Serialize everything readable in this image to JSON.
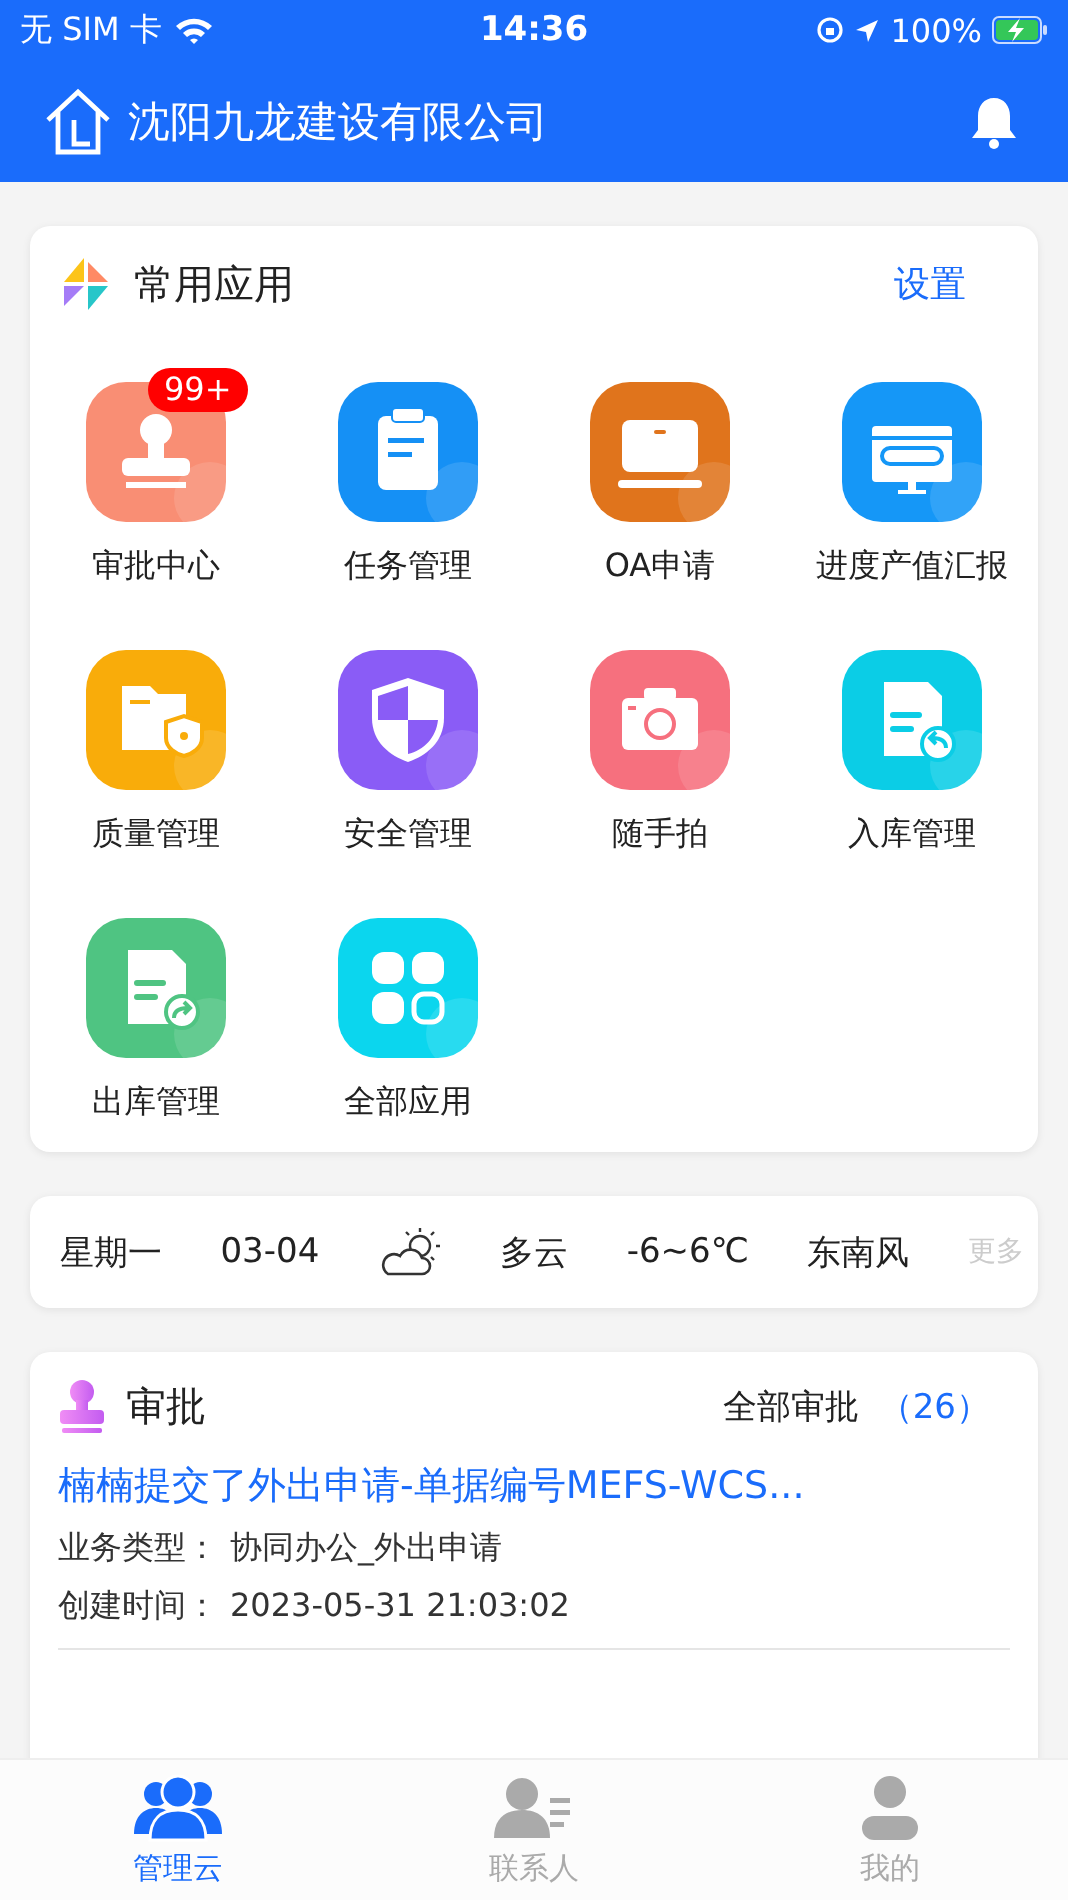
{
  "status_bar": {
    "carrier": "无 SIM 卡",
    "time": "14:36",
    "battery": "100%"
  },
  "header": {
    "title": "沈阳九龙建设有限公司"
  },
  "apps_card": {
    "title": "常用应用",
    "action": "设置",
    "apps": [
      {
        "label": "审批中心",
        "kind": "stamp",
        "color": "#f98e74",
        "badge": "99+"
      },
      {
        "label": "任务管理",
        "kind": "clipboard",
        "color": "#1590f5"
      },
      {
        "label": "OA申请",
        "kind": "laptop",
        "color": "#e0741c"
      },
      {
        "label": "进度产值汇报",
        "kind": "monitor",
        "color": "#1597f7"
      },
      {
        "label": "质量管理",
        "kind": "folder",
        "color": "#f9ac0a"
      },
      {
        "label": "安全管理",
        "kind": "shield",
        "color": "#8a5cf6"
      },
      {
        "label": "随手拍",
        "kind": "camera",
        "color": "#f6707e"
      },
      {
        "label": "入库管理",
        "kind": "doc-in",
        "color": "#0bcde6"
      },
      {
        "label": "出库管理",
        "kind": "doc-out",
        "color": "#4fc482"
      },
      {
        "label": "全部应用",
        "kind": "grid",
        "color": "#0bd6ee"
      }
    ]
  },
  "weather": {
    "weekday": "星期一",
    "date": "03-04",
    "condition": "多云",
    "temperature": "-6~6℃",
    "wind": "东南风",
    "more": "更多"
  },
  "approvals": {
    "title": "审批",
    "all_label": "全部审批",
    "count": "（26）",
    "items": [
      {
        "title": "楠楠提交了外出申请-单据编号MEFS-WCS...",
        "type_label": "业务类型：",
        "type": "协同办公_外出申请",
        "time_label": "创建时间：",
        "time": "2023-05-31 21:03:02"
      }
    ]
  },
  "tabs": [
    {
      "label": "管理云",
      "kind": "group",
      "selected": true
    },
    {
      "label": "联系人",
      "kind": "contact",
      "selected": false
    },
    {
      "label": "我的",
      "kind": "person",
      "selected": false
    }
  ]
}
